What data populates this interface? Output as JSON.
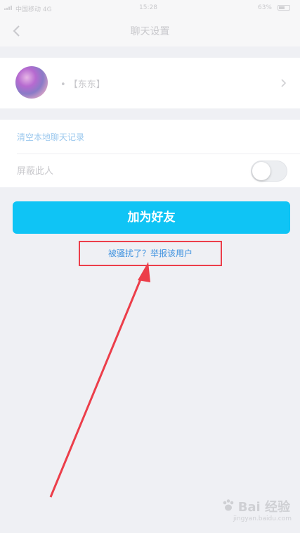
{
  "status_bar": {
    "carrier": "中国移动 4G",
    "time": "15:28",
    "battery": "63%"
  },
  "nav": {
    "title": "聊天设置"
  },
  "profile": {
    "nickname": "• 【东东】"
  },
  "settings": {
    "clear_history": "清空本地聊天记录",
    "block_label": "屏蔽此人",
    "block_enabled": false
  },
  "actions": {
    "add_friend": "加为好友",
    "report": "被骚扰了？举报该用户"
  },
  "watermark": {
    "brand": "Bai 经验",
    "url": "jingyan.baidu.com"
  },
  "colors": {
    "primary_button": "#0fc4f5",
    "link": "#3d91df",
    "annotation": "#ec3e4a"
  }
}
